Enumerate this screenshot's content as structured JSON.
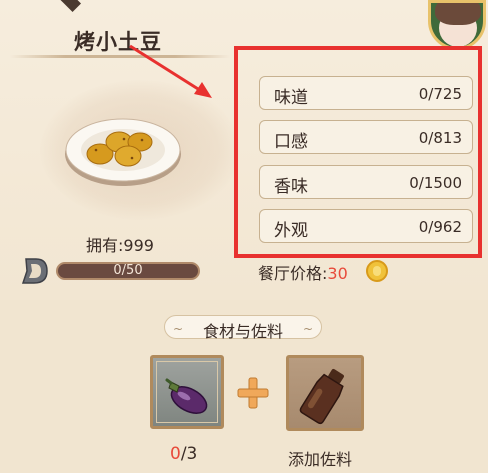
{
  "dish": {
    "name": "烤小土豆",
    "owned_label": "拥有:999",
    "progress": {
      "text": "0/50",
      "current": 0,
      "max": 50
    }
  },
  "stats": [
    {
      "label": "味道",
      "value": "0/725"
    },
    {
      "label": "口感",
      "value": "0/813"
    },
    {
      "label": "香味",
      "value": "0/1500"
    },
    {
      "label": "外观",
      "value": "0/962"
    }
  ],
  "price": {
    "label": "餐厅价格:",
    "value": "30"
  },
  "ingredients_section": {
    "title": "食材与佐料",
    "ingredient": {
      "icon": "eggplant-icon",
      "have": "0",
      "need": "/3"
    },
    "seasoning": {
      "icon": "soy-sauce-bottle-icon",
      "label": "添加佐料"
    }
  },
  "colors": {
    "highlight": "#e8312f",
    "price_value": "#e84a3a",
    "title_text": "#3a2c26"
  }
}
